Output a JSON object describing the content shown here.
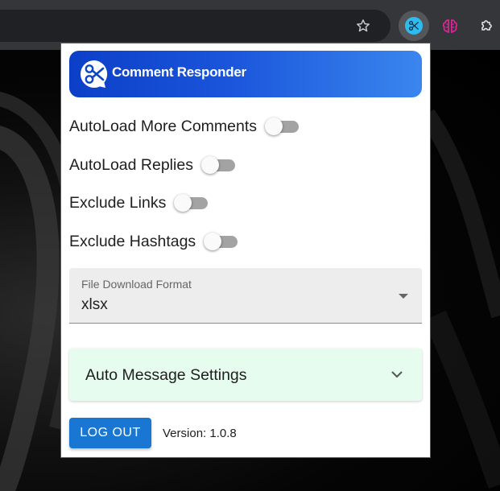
{
  "browser": {
    "bookmark_icon": "star-outline-icon",
    "extensions": [
      "comment-responder-extension-icon",
      "brain-extension-icon",
      "puzzle-extensions-icon"
    ]
  },
  "popup": {
    "header": {
      "title": "Comment Responder",
      "logo_icon": "scissors-chat-bubble-icon"
    },
    "toggles": [
      {
        "label": "AutoLoad More Comments",
        "checked": false
      },
      {
        "label": "AutoLoad Replies",
        "checked": false
      },
      {
        "label": "Exclude Links",
        "checked": false
      },
      {
        "label": "Exclude Hashtags",
        "checked": false
      }
    ],
    "file_format": {
      "label": "File Download Format",
      "value": "xlsx"
    },
    "accordion": {
      "title": "Auto Message Settings",
      "expanded": false
    },
    "logout_label": "LOG OUT",
    "version": "Version: 1.0.8"
  },
  "colors": {
    "header_gradient_start": "#0c3fc8",
    "header_gradient_end": "#3a86ee",
    "accordion_bg": "#e6fcef",
    "logout_button": "#1976d2",
    "toggle_track": "#a3a3a3",
    "extension_active": "#2dbbf0",
    "brain_icon": "#e0249a"
  }
}
